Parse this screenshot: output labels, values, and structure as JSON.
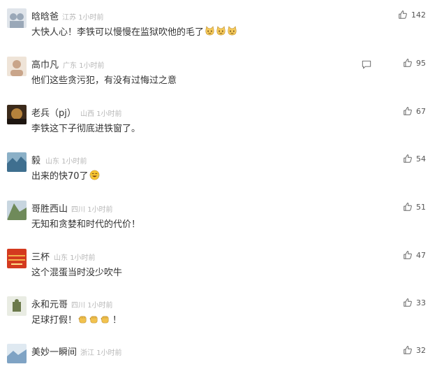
{
  "comments": [
    {
      "name": "晗晗爸",
      "location": "江苏",
      "time": "1小时前",
      "text": "大快人心！李铁可以慢慢在监狱吹他的毛了",
      "emojis": [
        "cat-emoji",
        "cat-emoji",
        "cat-emoji"
      ],
      "likes": "142",
      "show_reply": false,
      "avatar_colors": [
        "#9aa8b8",
        "#dfe4ea"
      ]
    },
    {
      "name": "高巾凡",
      "location": "广东",
      "time": "1小时前",
      "text": "他们这些贪污犯，有没有过悔过之意",
      "emojis": [],
      "likes": "95",
      "show_reply": true,
      "avatar_colors": [
        "#c9a58a",
        "#efe4d8"
      ]
    },
    {
      "name": "老兵（pj）",
      "location": "山西",
      "time": "1小时前",
      "text": "李铁这下子彻底进铁窗了。",
      "emojis": [],
      "likes": "67",
      "show_reply": false,
      "avatar_colors": [
        "#b5823c",
        "#3b2a1a"
      ]
    },
    {
      "name": "毅",
      "location": "山东",
      "time": "1小时前",
      "text": "出来的快70了",
      "emojis": [
        "crying-laughing-emoji"
      ],
      "likes": "54",
      "show_reply": false,
      "avatar_colors": [
        "#3f6f8f",
        "#8bb0c7"
      ]
    },
    {
      "name": "哥胜西山",
      "location": "四川",
      "time": "1小时前",
      "text": "无知和贪婪和时代的代价！",
      "emojis": [],
      "likes": "51",
      "show_reply": false,
      "avatar_colors": [
        "#6f8a5a",
        "#c8d6e0"
      ]
    },
    {
      "name": "三杯",
      "location": "山东",
      "time": "1小时前",
      "text": "这个混蛋当时没少吹牛",
      "emojis": [],
      "likes": "47",
      "show_reply": false,
      "avatar_colors": [
        "#d43a1f",
        "#f3b24a"
      ]
    },
    {
      "name": "永和元哥",
      "location": "四川",
      "time": "1小时前",
      "text": "足球打假！",
      "text_suffix": "！",
      "emojis": [
        "fist-emoji",
        "fist-emoji",
        "fist-emoji"
      ],
      "likes": "33",
      "show_reply": false,
      "avatar_colors": [
        "#6c7a4c",
        "#e9ece3"
      ]
    },
    {
      "name": "美妙一瞬间",
      "location": "浙江",
      "time": "1小时前",
      "text": "",
      "emojis": [],
      "likes": "32",
      "show_reply": false,
      "avatar_colors": [
        "#7fa3c4",
        "#dfe9f1"
      ]
    }
  ],
  "colors": {
    "name": "#333333",
    "meta": "#b7b7b7",
    "like": "#555555"
  }
}
